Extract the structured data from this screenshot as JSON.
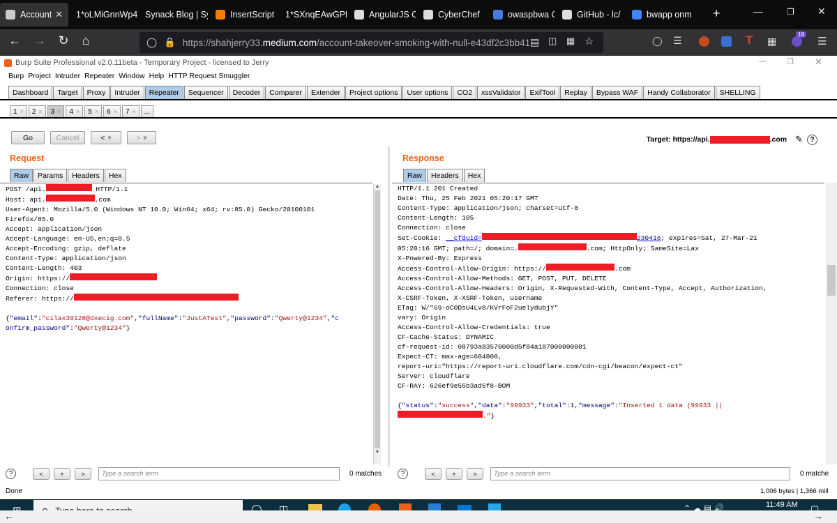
{
  "browser": {
    "tabs": [
      {
        "title": "Account",
        "fav": "globe-icon",
        "active": true
      },
      {
        "title": "1*oLMiGnnWp4",
        "fav": ""
      },
      {
        "title": "Synack Blog | Sy",
        "fav": ""
      },
      {
        "title": "InsertScript",
        "fav": "blogger-icon"
      },
      {
        "title": "1*SXnqEAwGPN",
        "fav": ""
      },
      {
        "title": "AngularJS C",
        "fav": "wordpress-icon"
      },
      {
        "title": "CyberChef",
        "fav": "chef-icon"
      },
      {
        "title": "owaspbwa C",
        "fav": "owasp-icon"
      },
      {
        "title": "GitHub - lc/",
        "fav": "github-icon"
      },
      {
        "title": "bwapp onm",
        "fav": "google-icon"
      }
    ],
    "url_prefix": "https://shahjerry33.",
    "url_domain": "medium.com",
    "url_path": "/account-takeover-smoking-with-null-e43df2c3bb41",
    "badge": "18"
  },
  "burp": {
    "title": "Burp Suite Professional v2.0.11beta - Temporary Project - licensed to Jerry",
    "menu": [
      "Burp",
      "Project",
      "Intruder",
      "Repeater",
      "Window",
      "Help",
      "HTTP Request Smuggler"
    ],
    "main_tabs": [
      "Dashboard",
      "Target",
      "Proxy",
      "Intruder",
      "Repeater",
      "Sequencer",
      "Decoder",
      "Comparer",
      "Extender",
      "Project options",
      "User options",
      "CO2",
      "xssValidator",
      "ExifTool",
      "Replay",
      "Bypass WAF",
      "Handy Collaborator",
      "SHELLING"
    ],
    "selected_main_tab": "Repeater",
    "repeater_tabs": [
      "1",
      "2",
      "3",
      "4",
      "5",
      "6",
      "7"
    ],
    "selected_repeater_tab": "3",
    "more_tabs": "...",
    "go_label": "Go",
    "cancel_label": "Cancel",
    "back_label": "<",
    "fwd_label": ">",
    "target_prefix": "Target: https://api.",
    "target_suffix": ".com",
    "request_title": "Request",
    "response_title": "Response",
    "request_tabs": [
      "Raw",
      "Params",
      "Headers",
      "Hex"
    ],
    "response_tabs": [
      "Raw",
      "Headers",
      "Hex"
    ],
    "request_lines": {
      "l1a": "POST /api.",
      "l1b": " HTTP/1.1",
      "l2a": "Host: api.",
      "l2b": ".com",
      "l3": "User-Agent: Mozilla/5.0 (Windows NT 10.0; Win64; x64; rv:85.0) Gecko/20100101",
      "l4": "Firefox/85.0",
      "l5": "Accept: application/json",
      "l6": "Accept-Language: en-US,en;q=0.5",
      "l7": "Accept-Encoding: gzip, deflate",
      "l8": "Content-Type: application/json",
      "l9": "Content-Length: 403",
      "l10": "Origin: https://",
      "l11": "Connection: close",
      "l12": "Referer: https://",
      "b1": "{",
      "b2": "\"email\"",
      "b3": ":",
      "b4": "\"cilax39128@dxecig.com\"",
      "b5": ",",
      "b6": "\"fullName\"",
      "b8": "\"JustATest\"",
      "b10": "\"password\"",
      "b12": "\"Qwerty@1234\"",
      "b14": "\"c",
      "b15": "onfirm_password\"",
      "b17": "\"Qwerty@1234\"",
      "b18": "}"
    },
    "response_lines": {
      "r1": "HTTP/1.1 201 Created",
      "r2": "Date: Thu, 25 Feb 2021 05:20:17 GMT",
      "r3": "Content-Type: application/json; charset=utf-8",
      "r4": "Content-Length: 105",
      "r5": "Connection: close",
      "r6a": "Set-Cookie: ",
      "r6b": "__cfduid=",
      "r6c": "230416",
      "r6d": "; expires=Sat, 27-Mar-21",
      "r7a": "05:20:16 GMT; path=/; domain=.",
      "r7b": ".com; HttpOnly; SameSite=Lax",
      "r8": "X-Powered-By: Express",
      "r9a": "Access-Control-Allow-Origin: https://",
      "r9b": ".com",
      "r10": "Access-Control-Allow-Methods: GET, POST, PUT, DELETE",
      "r11": "Access-Control-Allow-Headers: Origin, X-Requested-With, Content-Type, Accept, Authorization,",
      "r12": "X-CSRF-Token, X-XSRF-Token, username",
      "r13": "ETag: W/\"69-oC0DsU4Lv8/KVrFoF2uelydubjY\"",
      "r14": "vary: Origin",
      "r15": "Access-Control-Allow-Credentials: true",
      "r16": "CF-Cache-Status: DYNAMIC",
      "r17": "cf-request-id: 08793a83570000d5f84a187000000001",
      "r18": "Expect-CT: max-age=604800,",
      "r19": "report-uri=\"https://report-uri.cloudflare.com/cdn-cgi/beacon/expect-ct\"",
      "r20": "Server: cloudflare",
      "r21": "CF-RAY: 626ef9e55b3ad5f8-BOM",
      "rb1": "{",
      "rb2": "\"status\"",
      "rb3": ":",
      "rb4": "\"success\"",
      "rb5": ",",
      "rb6": "\"data\"",
      "rb8": "\"99933\"",
      "rb10": "\"total\"",
      "rb11": ":1,",
      "rb12": "\"message\"",
      "rb14": "\"Inserted 1 data (99933 ||",
      "rb15": ".\"",
      "rb16": "}"
    },
    "search_placeholder": "Type a search term",
    "matches_left": "0 matches",
    "matches_right": "0 matche",
    "prev": "<",
    "plus": "+",
    "next": ">",
    "help": "?",
    "status_left": "Done",
    "status_right": "1,006 bytes | 1,366 mill"
  },
  "taskbar": {
    "search_placeholder": "Type here to search",
    "time": "11:49 AM"
  }
}
